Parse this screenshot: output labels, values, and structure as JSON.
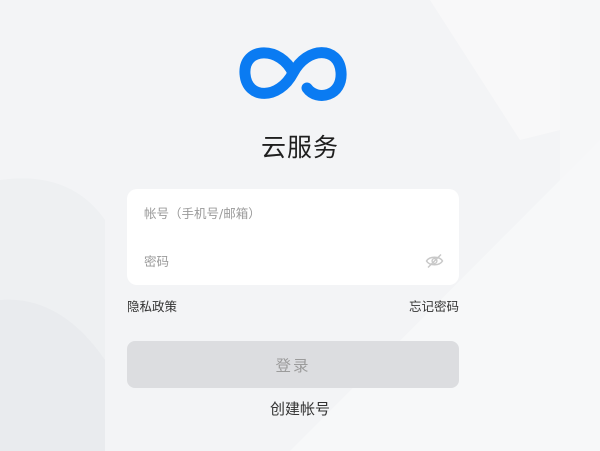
{
  "app": {
    "title": "云服务"
  },
  "form": {
    "account_placeholder": "帐号（手机号/邮箱）",
    "password_placeholder": "密码"
  },
  "links": {
    "privacy": "隐私政策",
    "forgot_password": "忘记密码",
    "create_account": "创建帐号"
  },
  "buttons": {
    "login": "登录"
  },
  "icons": {
    "password_toggle": "eye-off-icon",
    "logo": "infinity-logo-icon"
  },
  "colors": {
    "brand": "#0a7bf2",
    "background": "#f3f4f6",
    "login_button_disabled": "#dcdde0"
  }
}
